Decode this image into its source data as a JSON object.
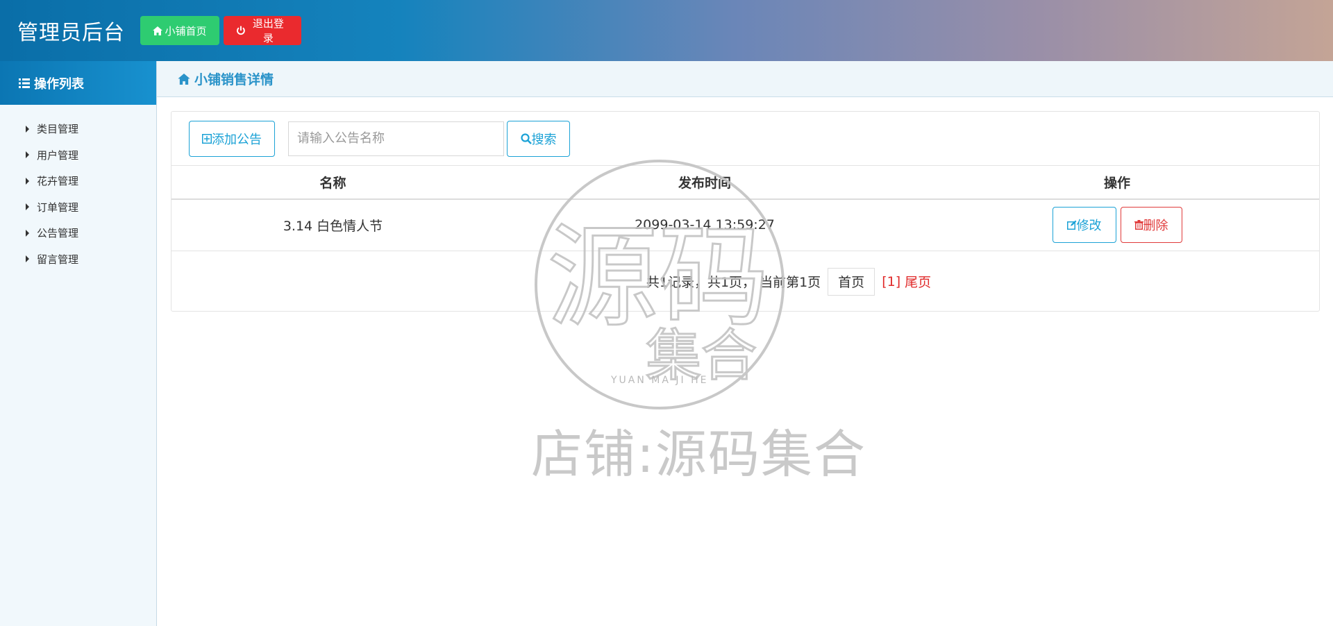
{
  "header": {
    "title": "管理员后台",
    "home_label": "小铺首页",
    "logout_label": "退出登录"
  },
  "sidebar": {
    "heading": "操作列表",
    "items": [
      {
        "label": "类目管理"
      },
      {
        "label": "用户管理"
      },
      {
        "label": "花卉管理"
      },
      {
        "label": "订单管理"
      },
      {
        "label": "公告管理"
      },
      {
        "label": "留言管理"
      }
    ]
  },
  "breadcrumb": {
    "title": "小铺销售详情"
  },
  "toolbar": {
    "add_label": "添加公告",
    "search_placeholder": "请输入公告名称",
    "search_label": "搜索"
  },
  "table": {
    "headers": [
      "名称",
      "发布时间",
      "操作"
    ],
    "rows": [
      {
        "name": "3.14 白色情人节",
        "time": "2099-03-14 13:59:27",
        "edit_label": "修改",
        "delete_label": "删除"
      }
    ]
  },
  "pager": {
    "summary": "共1记录，共1页， 当前第1页",
    "first_label": "首页",
    "current_label": "[1]",
    "last_label": "尾页"
  },
  "watermark": {
    "glyphs": "源码",
    "glyphs2": "集合",
    "caption": "YUAN MA JI HE",
    "shop": "店铺:源码集合"
  },
  "colors": {
    "header_start": "#0a6ea8",
    "header_end": "#c4a496",
    "green": "#2ecc71",
    "red": "#ea2a2e",
    "accent": "#1ba2d6"
  }
}
